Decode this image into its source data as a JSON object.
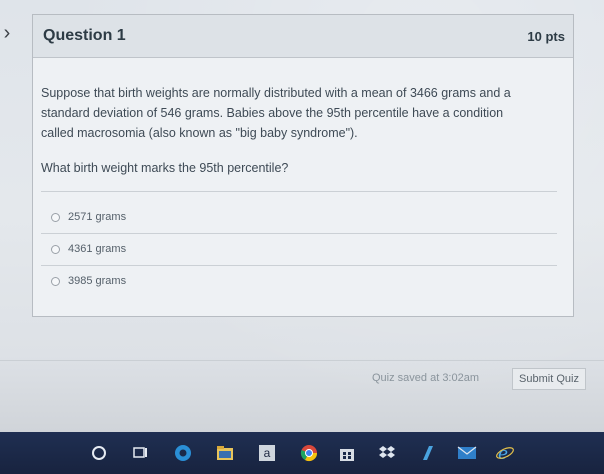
{
  "question": {
    "title": "Question 1",
    "points": "10 pts",
    "body_lines": [
      "Suppose that birth weights are normally distributed with a mean of 3466 grams and a",
      "standard deviation of 546 grams. Babies above the 95th percentile have a condition",
      "called macrosomia (also known as \"big baby syndrome\")."
    ],
    "prompt": "What birth weight marks the 95th percentile?",
    "answers": [
      {
        "label": "2571 grams"
      },
      {
        "label": "4361 grams"
      },
      {
        "label": "3985 grams"
      }
    ]
  },
  "footer": {
    "saved_text": "Quiz saved at 3:02am",
    "submit_label": "Submit Quiz"
  },
  "taskbar": {
    "icons": [
      "search-circle-icon",
      "task-view-icon",
      "edge-browser-icon",
      "file-explorer-icon",
      "amazon-icon",
      "chrome-icon",
      "store-icon",
      "dropbox-icon",
      "app-icon",
      "mail-icon",
      "internet-explorer-icon"
    ],
    "amazon_letter": "a"
  },
  "colors": {
    "taskbar": "#1f2f52",
    "card": "#eef1f4",
    "header": "#dde2e7",
    "text": "#2d3b45"
  }
}
